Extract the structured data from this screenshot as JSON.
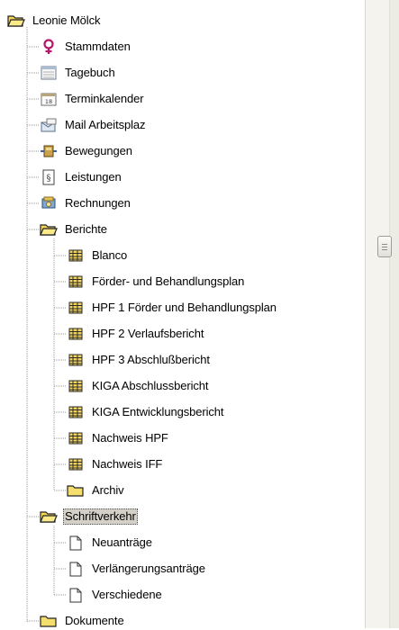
{
  "tree": {
    "root": {
      "label": "Leonie Mölck",
      "icon": "open-folder-icon"
    },
    "items": [
      {
        "label": "Stammdaten",
        "icon": "female-symbol-icon"
      },
      {
        "label": "Tagebuch",
        "icon": "diary-icon"
      },
      {
        "label": "Terminkalender",
        "icon": "calendar-icon"
      },
      {
        "label": "Mail Arbeitsplaz",
        "icon": "mail-icon"
      },
      {
        "label": "Bewegungen",
        "icon": "movements-icon"
      },
      {
        "label": "Leistungen",
        "icon": "paragraph-document-icon"
      },
      {
        "label": "Rechnungen",
        "icon": "invoice-icon"
      },
      {
        "label": "Berichte",
        "icon": "open-folder-icon"
      }
    ],
    "berichte_children": [
      {
        "label": "Blanco",
        "icon": "report-icon"
      },
      {
        "label": "Förder- und Behandlungsplan",
        "icon": "report-icon"
      },
      {
        "label": "HPF 1 Förder und Behandlungsplan",
        "icon": "report-icon"
      },
      {
        "label": "HPF 2 Verlaufsbericht",
        "icon": "report-icon"
      },
      {
        "label": "HPF 3 Abschlußbericht",
        "icon": "report-icon"
      },
      {
        "label": "KIGA Abschlussbericht",
        "icon": "report-icon"
      },
      {
        "label": "KIGA Entwicklungsbericht",
        "icon": "report-icon"
      },
      {
        "label": "Nachweis HPF",
        "icon": "report-icon"
      },
      {
        "label": "Nachweis IFF",
        "icon": "report-icon"
      },
      {
        "label": "Archiv",
        "icon": "folder-icon"
      }
    ],
    "schriftverkehr": {
      "label": "Schriftverkehr",
      "icon": "open-folder-icon",
      "selected": true
    },
    "schriftverkehr_children": [
      {
        "label": "Neuanträge",
        "icon": "blank-document-icon"
      },
      {
        "label": "Verlängerungsanträge",
        "icon": "blank-document-icon"
      },
      {
        "label": "Verschiedene",
        "icon": "blank-document-icon"
      }
    ],
    "dokumente": {
      "label": "Dokumente",
      "icon": "folder-icon"
    }
  }
}
